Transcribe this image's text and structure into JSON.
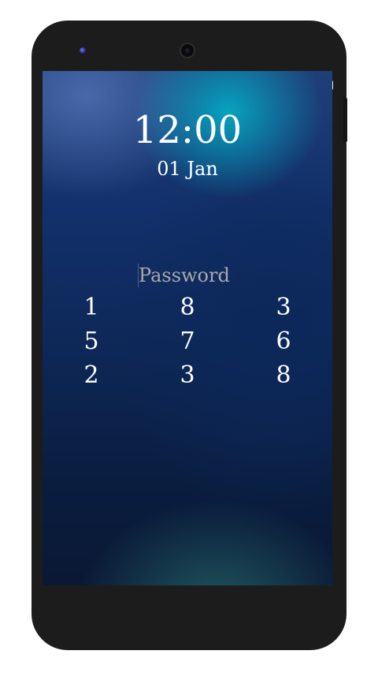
{
  "lockscreen": {
    "time": "12:00",
    "date": "01 Jan",
    "password_placeholder": "Password",
    "password_value": "",
    "keypad": {
      "row1": [
        "1",
        "8",
        "3"
      ],
      "row2": [
        "5",
        "7",
        "6"
      ],
      "row3": [
        "2",
        "3",
        "8"
      ]
    }
  },
  "colors": {
    "device_body": "#1c1c1c",
    "text": "#ffffff",
    "placeholder": "#a9a9a9"
  }
}
